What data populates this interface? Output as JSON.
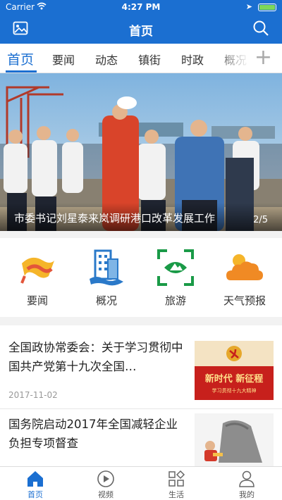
{
  "status": {
    "carrier": "Carrier",
    "time": "4:27 PM"
  },
  "navbar": {
    "title": "首页"
  },
  "tabs": [
    {
      "label": "首页",
      "active": true
    },
    {
      "label": "要闻"
    },
    {
      "label": "动态"
    },
    {
      "label": "镇街"
    },
    {
      "label": "时政"
    },
    {
      "label": "概况"
    }
  ],
  "tab_add": "+",
  "banner": {
    "caption": "市委书记刘星泰来岚调研港口改革发展工作",
    "counter": "2/5"
  },
  "shortcuts": [
    {
      "label": "要闻",
      "icon": "news-flag-icon"
    },
    {
      "label": "概况",
      "icon": "building-icon"
    },
    {
      "label": "旅游",
      "icon": "scenery-frame-icon"
    },
    {
      "label": "天气预报",
      "icon": "weather-cloud-icon"
    }
  ],
  "news": [
    {
      "title": "全国政协常委会：关于学习贯彻中国共产党第十九次全国…",
      "date": "2017-11-02",
      "thumb_text": "新时代 新征程",
      "thumb_sub": "学习贯彻十九大精神"
    },
    {
      "title": "国务院启动2017年全国减轻企业负担专项督查",
      "date": ""
    }
  ],
  "bottom_tabs": [
    {
      "label": "首页",
      "active": true
    },
    {
      "label": "视频"
    },
    {
      "label": "生活"
    },
    {
      "label": "我的"
    }
  ],
  "colors": {
    "brand": "#1b6fd1",
    "shortcut_blue": "#2a79c9",
    "shortcut_green": "#1a9a47",
    "shortcut_orange": "#f08a24"
  }
}
